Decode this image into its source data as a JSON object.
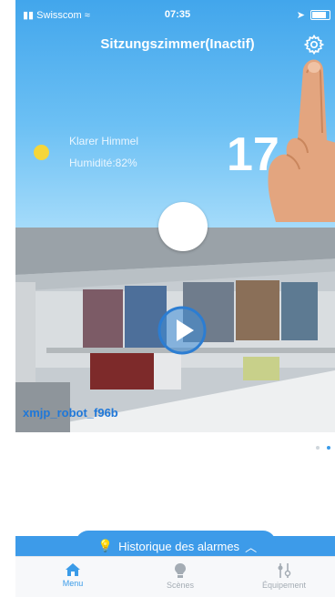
{
  "status_bar": {
    "carrier": "Swisscom",
    "time": "07:35"
  },
  "header": {
    "title": "Sitzungszimmer(Inactif)"
  },
  "weather": {
    "condition": "Klarer Himmel",
    "humidity": "Humidité:82%",
    "temperature": "17"
  },
  "camera": {
    "device_name": "xmjp_robot_f96b"
  },
  "pager": {
    "count": 2,
    "active_index": 1
  },
  "alarm_bar": {
    "label": "Historique des alarmes"
  },
  "tabs": [
    {
      "label": "Menu",
      "active": true
    },
    {
      "label": "Scènes",
      "active": false
    },
    {
      "label": "Équipement",
      "active": false
    }
  ],
  "colors": {
    "primary": "#3a9be8",
    "header_top": "#42a6ec",
    "sun": "#f5d63a"
  }
}
